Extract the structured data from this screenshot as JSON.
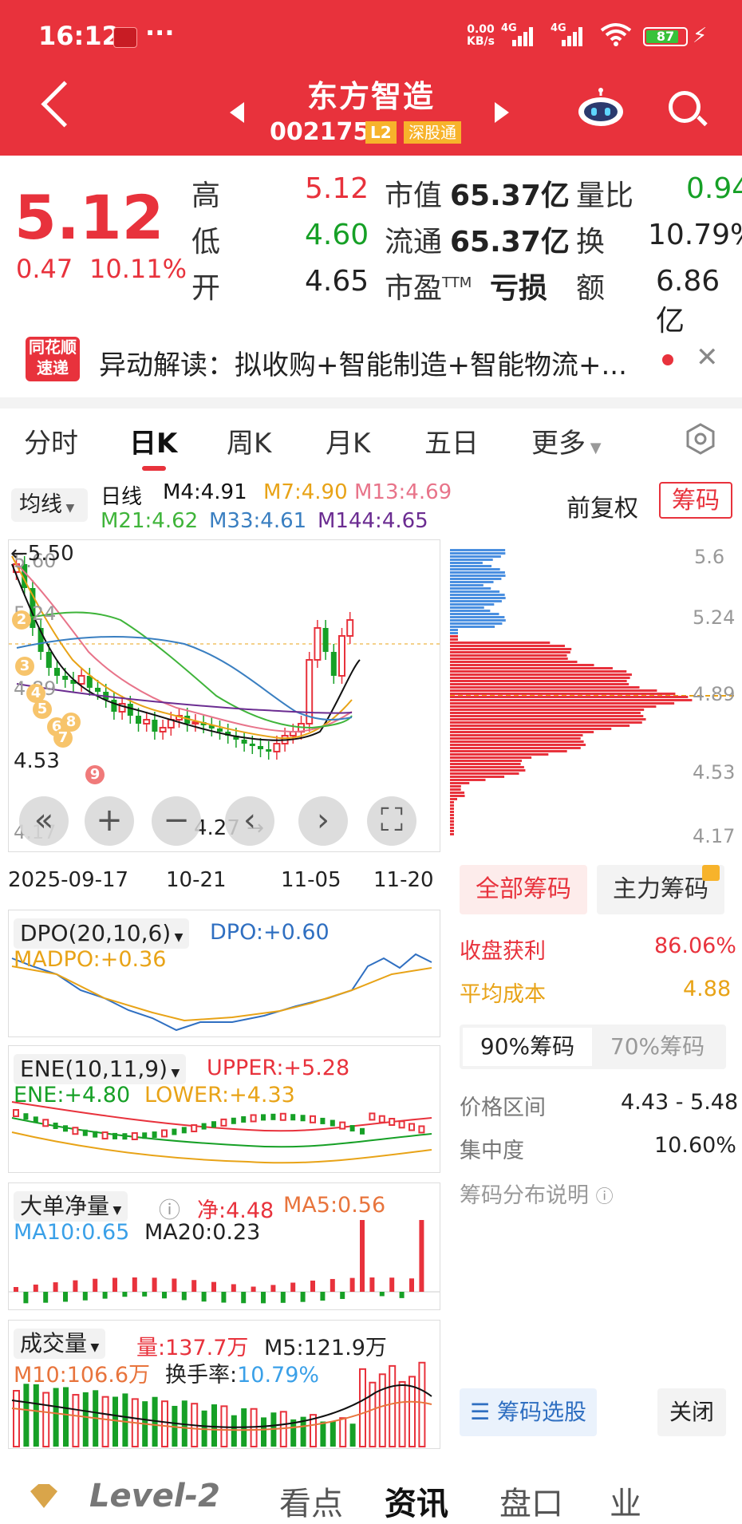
{
  "status_bar": {
    "time": "16:12",
    "dots": "···",
    "net_speed_value": "0.00",
    "net_speed_unit": "KB/s",
    "signal_1": "4G",
    "signal_2": "4G",
    "battery": "87"
  },
  "header": {
    "stock_name": "东方智造",
    "stock_code": "002175",
    "level_badge": "L2",
    "market_badge": "深股通"
  },
  "quote": {
    "price": "5.12",
    "change": "0.47",
    "change_pct": "10.11%",
    "high_label": "高",
    "high": "5.12",
    "low_label": "低",
    "low": "4.60",
    "open_label": "开",
    "open": "4.65",
    "mktcap_label": "市值",
    "mktcap": "65.37亿",
    "float_label": "流通",
    "float_cap": "65.37亿",
    "pe_label": "市盈",
    "pe_sup": "TTM",
    "pe": "亏损",
    "volratio_label": "量比",
    "volratio": "0.94",
    "turnover_label": "换",
    "turnover": "10.79%",
    "amount_label": "额",
    "amount": "6.86亿"
  },
  "news": {
    "logo_line1": "同花顺",
    "logo_line2": "速递",
    "text": "异动解读：拟收购+智能制造+智能物流+..."
  },
  "tabs": [
    "分时",
    "日K",
    "周K",
    "月K",
    "五日",
    "更多"
  ],
  "chart_controls": {
    "ma_select": "均线",
    "period": "日线",
    "adjust": "前复权",
    "chips_button": "筹码"
  },
  "ma_values": [
    {
      "label": "M4:4.91",
      "color": "#111111"
    },
    {
      "label": "M7:4.90",
      "color": "#e8a317"
    },
    {
      "label": "M13:4.69",
      "color": "#e8748a"
    },
    {
      "label": "M21:4.62",
      "color": "#3fb43a"
    },
    {
      "label": "M33:4.61",
      "color": "#3a7fc1"
    },
    {
      "label": "M144:4.65",
      "color": "#6b2c91"
    }
  ],
  "kline": {
    "y_labels": [
      "5.60",
      "5.24",
      "4.89",
      "4.53",
      "4.17"
    ],
    "high_annotation": "5.50",
    "low_annotation": "4.27",
    "x_labels": [
      "2025-09-17",
      "10-21",
      "11-05",
      "11-20"
    ],
    "badges": [
      "2",
      "3",
      "4",
      "5",
      "6",
      "7",
      "8",
      "9"
    ]
  },
  "chip_chart": {
    "y_labels": [
      "5.6",
      "5.24",
      "4.89",
      "4.53",
      "4.17"
    ]
  },
  "chip_panel": {
    "tab_all": "全部筹码",
    "tab_main": "主力筹码",
    "profit_label": "收盘获利",
    "profit": "86.06%",
    "avg_cost_label": "平均成本",
    "avg_cost": "4.88",
    "tab_90": "90%筹码",
    "tab_70": "70%筹码",
    "range_label": "价格区间",
    "range": "4.43 - 5.48",
    "concentration_label": "集中度",
    "concentration": "10.60%",
    "explain": "筹码分布说明",
    "select_button": "筹码选股",
    "close_button": "关闭"
  },
  "dpo": {
    "name": "DPO(20,10,6)",
    "dpo": "DPO:+0.60",
    "madpo": "MADPO:+0.36"
  },
  "ene": {
    "name": "ENE(10,11,9)",
    "upper": "UPPER:+5.28",
    "ene": "ENE:+4.80",
    "lower": "LOWER:+4.33"
  },
  "bigorder": {
    "name": "大单净量",
    "net": "净:4.48",
    "ma5": "MA5:0.56",
    "ma10": "MA10:0.65",
    "ma20": "MA20:0.23"
  },
  "volume": {
    "name": "成交量",
    "vol": "量:137.7万",
    "m5": "M5:121.9万",
    "m10": "M10:106.6万",
    "turnover_label": "换手率:",
    "turnover": "10.79%"
  },
  "bottom_nav": [
    "Level-2",
    "看点",
    "资讯",
    "盘口",
    "业"
  ],
  "colors": {
    "red": "#e8323c",
    "green": "#16a026",
    "blue": "#3a7fc1",
    "orange": "#e8a317"
  }
}
